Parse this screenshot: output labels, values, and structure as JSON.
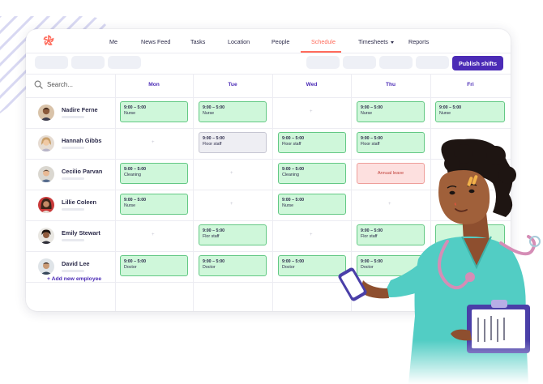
{
  "nav": {
    "items": [
      "Me",
      "News Feed",
      "Tasks",
      "Location",
      "People",
      "Schedule",
      "Timesheets",
      "Reports"
    ],
    "active": "Schedule"
  },
  "toolbar": {
    "publish_label": "Publish shifts"
  },
  "search": {
    "placeholder": "Search..."
  },
  "days": [
    "Mon",
    "Tue",
    "Wed",
    "Thu",
    "Fri"
  ],
  "employees": [
    {
      "name": "Nadire Ferne"
    },
    {
      "name": "Hannah Gibbs"
    },
    {
      "name": "Cecilio Parvan"
    },
    {
      "name": "Lillie Coleen"
    },
    {
      "name": "Emily Stewart"
    },
    {
      "name": "David Lee"
    }
  ],
  "shifts": {
    "r0": {
      "mon": {
        "time": "9:00 – 5:00",
        "role": "Nurse"
      },
      "tue": {
        "time": "9:00 – 5:00",
        "role": "Nurse"
      },
      "thu": {
        "time": "9:00 – 5:00",
        "role": "Nurse"
      },
      "fri": {
        "time": "9:00 – 5:00",
        "role": "Nurse"
      }
    },
    "r1": {
      "tue": {
        "time": "9:00 – 5:00",
        "role": "Floor staff"
      },
      "wed": {
        "time": "9:00 – 5:00",
        "role": "Floor staff"
      },
      "thu": {
        "time": "9:00 – 5:00",
        "role": "Floor staff"
      }
    },
    "r2": {
      "mon": {
        "time": "9:00 – 5:00",
        "role": "Cleaning"
      },
      "wed": {
        "time": "9:00 – 5:00",
        "role": "Cleaning"
      },
      "thu": {
        "label": "Annual leave"
      }
    },
    "r3": {
      "mon": {
        "time": "9:00 – 5:00",
        "role": "Nurse"
      },
      "wed": {
        "time": "9:00 – 5:00",
        "role": "Nurse"
      }
    },
    "r4": {
      "tue": {
        "time": "9:00 – 5:00",
        "role": "Flor staff"
      },
      "thu": {
        "time": "9:00 – 5:00",
        "role": "Flor staff"
      }
    },
    "r5": {
      "mon": {
        "time": "9:00 – 5:00",
        "role": "Doctor"
      },
      "tue": {
        "time": "9:00 – 5:00",
        "role": "Doctor"
      },
      "wed": {
        "time": "9:00 – 5:00",
        "role": "Doctor"
      },
      "thu": {
        "time": "9:00 – 5:00",
        "role": "Doctor"
      }
    }
  },
  "footer": {
    "add_employee": "+ Add new employee"
  },
  "colors": {
    "brand": "#ff6b5b",
    "primary": "#4b2bb6",
    "shift_green": "#cff7da",
    "shift_green_border": "#63c884",
    "leave_red": "#fde0df",
    "pending_grey": "#eeeef3"
  }
}
